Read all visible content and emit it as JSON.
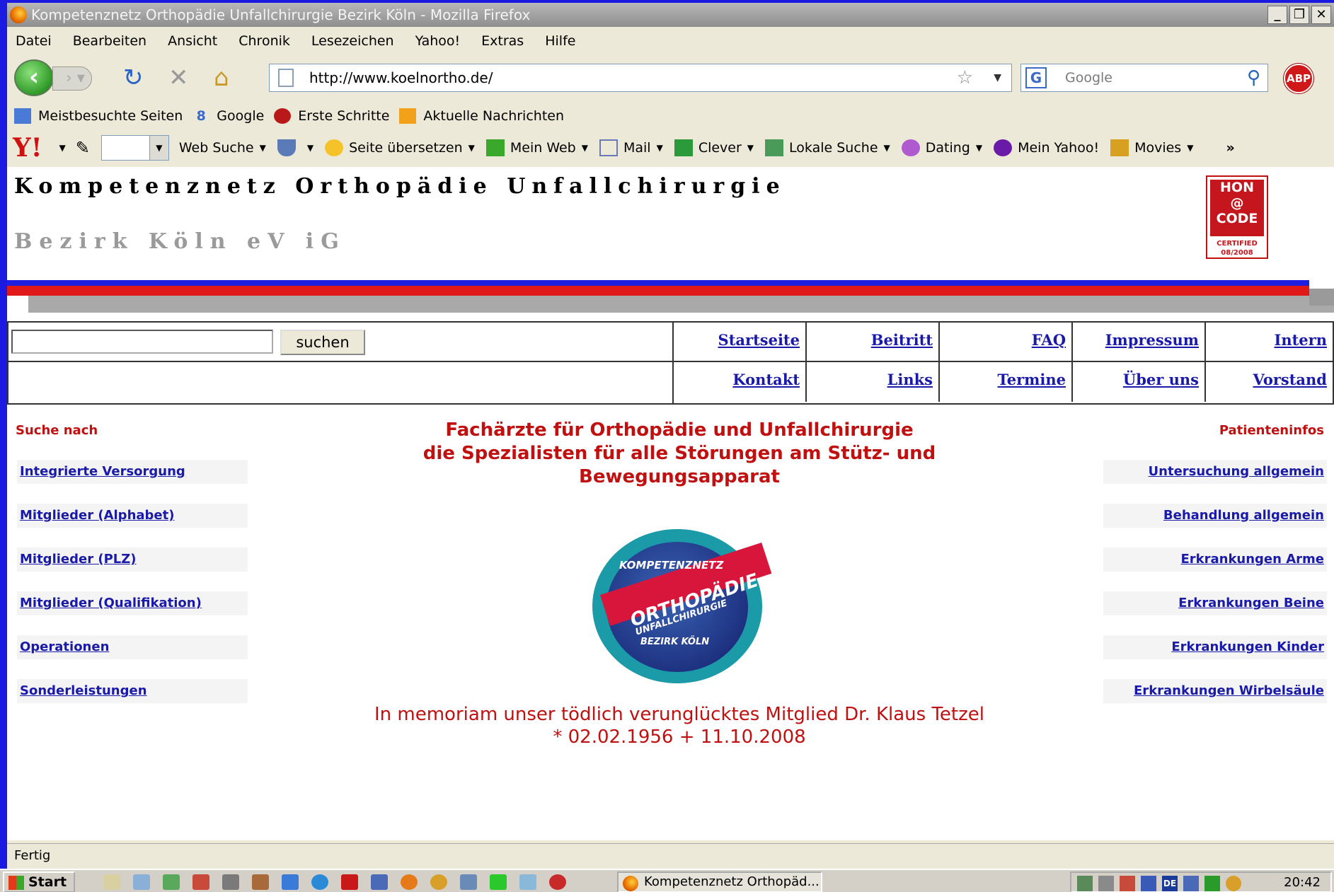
{
  "window": {
    "title": "Kompetenznetz Orthopädie Unfallchirurgie Bezirk Köln - Mozilla Firefox"
  },
  "menu": [
    "Datei",
    "Bearbeiten",
    "Ansicht",
    "Chronik",
    "Lesezeichen",
    "Yahoo!",
    "Extras",
    "Hilfe"
  ],
  "navigation": {
    "url": "http://www.koelnortho.de/",
    "search_placeholder": "Google",
    "search_engine_letter": "G",
    "adblock_label": "ABP"
  },
  "bookmarks": [
    "Meistbesuchte Seiten",
    "Google",
    "Erste Schritte",
    "Aktuelle Nachrichten"
  ],
  "yahoo_toolbar": {
    "logo": "Y!",
    "items": [
      "Web Suche",
      "Seite übersetzen",
      "Mein Web",
      "Mail",
      "Clever",
      "Lokale Suche",
      "Dating",
      "Mein Yahoo!",
      "Movies"
    ],
    "more": "»"
  },
  "page": {
    "title": "Kompetenznetz Orthopädie Unfallchirurgie",
    "subtitle": "Bezirk Köln eV iG",
    "hon": {
      "line1": "HON",
      "line2": "@",
      "line3": "CODE",
      "cert1": "CERTIFIED",
      "cert2": "08/2008"
    },
    "search_button": "suchen",
    "nav_row1": [
      "Startseite",
      "Beitritt",
      "FAQ",
      "Impressum",
      "Intern"
    ],
    "nav_row2": [
      "Kontakt",
      "Links",
      "Termine",
      "Über uns",
      "Vorstand"
    ],
    "left_heading": "Suche nach",
    "left_links": [
      "Integrierte Versorgung",
      "Mitglieder (Alphabet)",
      "Mitglieder (PLZ)",
      "Mitglieder (Qualifikation)",
      "Operationen",
      "Sonderleistungen"
    ],
    "right_heading": "Patienteninfos",
    "right_links": [
      "Untersuchung allgemein",
      "Behandlung allgemein",
      "Erkrankungen Arme",
      "Erkrankungen Beine",
      "Erkrankungen Kinder",
      "Erkrankungen Wirbelsäule"
    ],
    "headline": [
      "Fachärzte für Orthopädie und Unfallchirurgie",
      "die Spezialisten für alle Störungen am Stütz- und",
      "Bewegungsapparat"
    ],
    "logo_text": {
      "top": "KOMPETENZNETZ",
      "main": "ORTHOPÄDIE",
      "sub": "UNFALLCHIRURGIE",
      "bottom": "BEZIRK KÖLN"
    },
    "memoriam": [
      "In memoriam unser tödlich verunglücktes Mitglied Dr. Klaus Tetzel",
      "* 02.02.1956 + 11.10.2008"
    ]
  },
  "status": "Fertig",
  "taskbar": {
    "start": "Start",
    "task": "Kompetenznetz Orthopäd...",
    "clock": "20:42",
    "lang": "DE"
  },
  "colors": {
    "accent_red": "#c01010",
    "link_blue": "#1a1aa8",
    "stripe_blue": "#1f1fe0",
    "stripe_red": "#e01818"
  }
}
